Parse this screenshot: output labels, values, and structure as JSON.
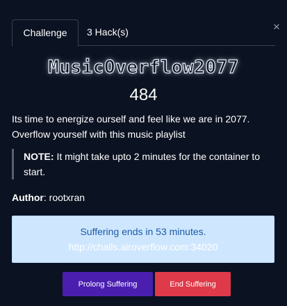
{
  "tabs": [
    {
      "label": "Challenge"
    },
    {
      "label": "3 Hack(s)"
    }
  ],
  "close_glyph": "×",
  "challenge": {
    "name": "MusicOverflow2077",
    "points": "484",
    "description_line1": "Its time to energize ourself and feel like we are in 2077.",
    "description_line2": "Overflow yourself with this music playlist",
    "note_label": "NOTE:",
    "note_text": " It might take upto 2 minutes for the container to start.",
    "author_label": "Author",
    "author_name": ": rootxran"
  },
  "instance": {
    "status": "Suffering ends in 53 minutes.",
    "url": "http://challs.airoverflow.com:34020"
  },
  "buttons": {
    "prolong": "Prolong Suffering",
    "end": "End Suffering"
  },
  "colors": {
    "background": "#0b1221",
    "info_bg": "#cfe7fe",
    "info_text": "#1b5aa6",
    "prolong_btn": "#4a1fb0",
    "end_btn": "#df3a4a"
  }
}
